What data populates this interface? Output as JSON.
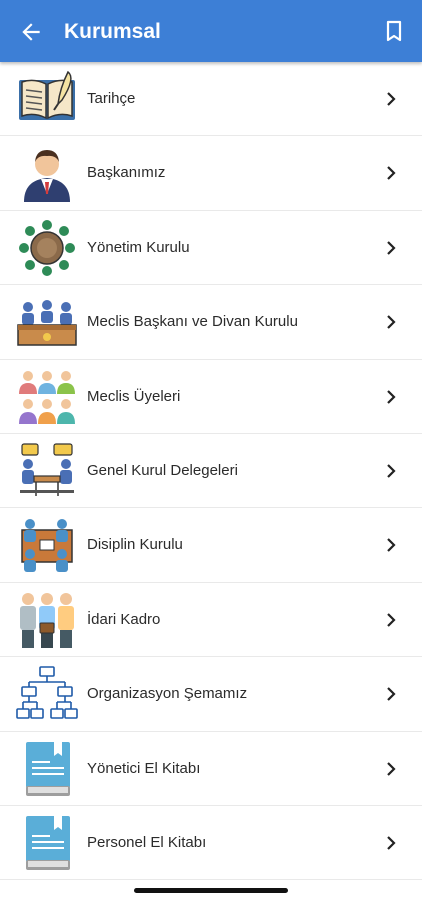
{
  "appbar": {
    "title": "Kurumsal",
    "back_icon": "arrow-left-icon",
    "action_icon": "bookmark-icon",
    "color": "#3d7fd6"
  },
  "menu": {
    "items": [
      {
        "label": "Tarihçe",
        "icon": "history-book-icon"
      },
      {
        "label": "Başkanımız",
        "icon": "president-icon"
      },
      {
        "label": "Yönetim Kurulu",
        "icon": "board-meeting-icon"
      },
      {
        "label": "Meclis Başkanı ve Divan Kurulu",
        "icon": "assembly-council-icon"
      },
      {
        "label": "Meclis Üyeleri",
        "icon": "members-group-icon"
      },
      {
        "label": "Genel Kurul Delegeleri",
        "icon": "delegates-icon"
      },
      {
        "label": "Disiplin Kurulu",
        "icon": "discipline-committee-icon"
      },
      {
        "label": "İdari Kadro",
        "icon": "admin-staff-icon"
      },
      {
        "label": "Organizasyon Şemamız",
        "icon": "org-chart-icon"
      },
      {
        "label": "Yönetici El Kitabı",
        "icon": "handbook-icon"
      },
      {
        "label": "Personel El Kitabı",
        "icon": "handbook-icon"
      }
    ]
  }
}
